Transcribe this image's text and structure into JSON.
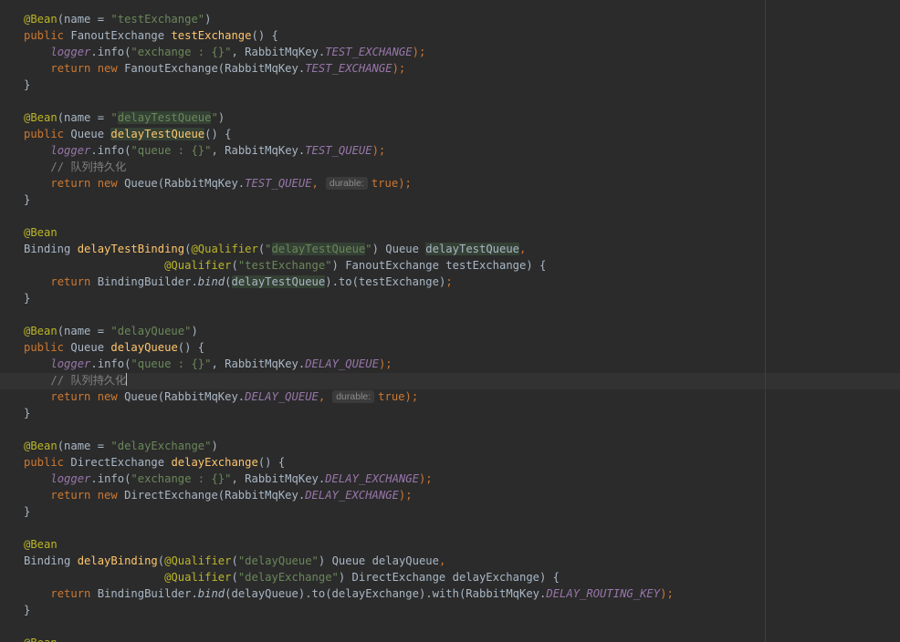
{
  "editor": {
    "lines": [
      {
        "indent": "",
        "tokens": [
          {
            "t": "@Bean",
            "c": "ann"
          },
          {
            "t": "(name = "
          },
          {
            "t": "\"testExchange\"",
            "c": "str"
          },
          {
            "t": ")"
          }
        ]
      },
      {
        "indent": "",
        "tokens": [
          {
            "t": "public",
            "c": "kw"
          },
          {
            "t": " FanoutExchange "
          },
          {
            "t": "testExchange",
            "c": "fn"
          },
          {
            "t": "() {"
          }
        ]
      },
      {
        "indent": "    ",
        "tokens": [
          {
            "t": "logger",
            "c": "field italic"
          },
          {
            "t": ".info("
          },
          {
            "t": "\"exchange : {}\"",
            "c": "str"
          },
          {
            "t": ", RabbitMqKey."
          },
          {
            "t": "TEST_EXCHANGE",
            "c": "const"
          },
          {
            "t": ");",
            "c": "kw"
          }
        ]
      },
      {
        "indent": "    ",
        "tokens": [
          {
            "t": "return new",
            "c": "kw"
          },
          {
            "t": " FanoutExchange(RabbitMqKey."
          },
          {
            "t": "TEST_EXCHANGE",
            "c": "const"
          },
          {
            "t": ");",
            "c": "kw"
          }
        ]
      },
      {
        "indent": "",
        "tokens": [
          {
            "t": "}"
          }
        ]
      },
      {
        "indent": "",
        "tokens": []
      },
      {
        "indent": "",
        "tokens": [
          {
            "t": "@Bean",
            "c": "ann"
          },
          {
            "t": "(name = "
          },
          {
            "t": "\"",
            "c": "str"
          },
          {
            "t": "delayTestQueue",
            "c": "str hl"
          },
          {
            "t": "\"",
            "c": "str"
          },
          {
            "t": ")"
          }
        ]
      },
      {
        "indent": "",
        "tokens": [
          {
            "t": "public",
            "c": "kw"
          },
          {
            "t": " Queue "
          },
          {
            "t": "delayTestQueue",
            "c": "fn hl"
          },
          {
            "t": "() {"
          }
        ]
      },
      {
        "indent": "    ",
        "tokens": [
          {
            "t": "logger",
            "c": "field italic"
          },
          {
            "t": ".info("
          },
          {
            "t": "\"queue : {}\"",
            "c": "str"
          },
          {
            "t": ", RabbitMqKey."
          },
          {
            "t": "TEST_QUEUE",
            "c": "const"
          },
          {
            "t": ");",
            "c": "kw"
          }
        ]
      },
      {
        "indent": "    ",
        "tokens": [
          {
            "t": "// 队列持久化",
            "c": "comment"
          }
        ]
      },
      {
        "indent": "    ",
        "tokens": [
          {
            "t": "return new",
            "c": "kw"
          },
          {
            "t": " Queue(RabbitMqKey."
          },
          {
            "t": "TEST_QUEUE",
            "c": "const"
          },
          {
            "t": ",",
            "c": "kw"
          },
          {
            "t": "durable:",
            "hint": true
          },
          {
            "t": "true",
            "c": "kw"
          },
          {
            "t": ");",
            "c": "kw"
          }
        ]
      },
      {
        "indent": "",
        "tokens": [
          {
            "t": "}"
          }
        ]
      },
      {
        "indent": "",
        "tokens": []
      },
      {
        "indent": "",
        "tokens": [
          {
            "t": "@Bean",
            "c": "ann"
          }
        ]
      },
      {
        "indent": "",
        "tokens": [
          {
            "t": "Binding "
          },
          {
            "t": "delayTestBinding",
            "c": "fn"
          },
          {
            "t": "("
          },
          {
            "t": "@Qualifier",
            "c": "ann"
          },
          {
            "t": "("
          },
          {
            "t": "\"",
            "c": "str"
          },
          {
            "t": "delayTestQueue",
            "c": "str hl"
          },
          {
            "t": "\"",
            "c": "str"
          },
          {
            "t": ") Queue "
          },
          {
            "t": "delayTestQueue",
            "c": "hl"
          },
          {
            "t": ",",
            "c": "kw"
          }
        ]
      },
      {
        "indent": "                     ",
        "tokens": [
          {
            "t": "@Qualifier",
            "c": "ann"
          },
          {
            "t": "("
          },
          {
            "t": "\"testExchange\"",
            "c": "str"
          },
          {
            "t": ") FanoutExchange testExchange) {"
          }
        ]
      },
      {
        "indent": "    ",
        "tokens": [
          {
            "t": "return",
            "c": "kw"
          },
          {
            "t": " BindingBuilder."
          },
          {
            "t": "bind",
            "c": "italic"
          },
          {
            "t": "("
          },
          {
            "t": "delayTestQueue",
            "c": "hl"
          },
          {
            "t": ").to(testExchange)"
          },
          {
            "t": ";",
            "c": "kw"
          }
        ]
      },
      {
        "indent": "",
        "tokens": [
          {
            "t": "}"
          }
        ]
      },
      {
        "indent": "",
        "tokens": []
      },
      {
        "indent": "",
        "tokens": [
          {
            "t": "@Bean",
            "c": "ann"
          },
          {
            "t": "(name = "
          },
          {
            "t": "\"delayQueue\"",
            "c": "str"
          },
          {
            "t": ")"
          }
        ]
      },
      {
        "indent": "",
        "tokens": [
          {
            "t": "public",
            "c": "kw"
          },
          {
            "t": " Queue "
          },
          {
            "t": "delayQueue",
            "c": "fn"
          },
          {
            "t": "() {"
          }
        ]
      },
      {
        "indent": "    ",
        "tokens": [
          {
            "t": "logger",
            "c": "field italic"
          },
          {
            "t": ".info("
          },
          {
            "t": "\"queue : {}\"",
            "c": "str"
          },
          {
            "t": ", RabbitMqKey."
          },
          {
            "t": "DELAY_QUEUE",
            "c": "const"
          },
          {
            "t": ");",
            "c": "kw"
          }
        ]
      },
      {
        "indent": "    ",
        "caret": true,
        "tokens": [
          {
            "t": "// 队列持久化",
            "c": "comment"
          }
        ]
      },
      {
        "indent": "    ",
        "tokens": [
          {
            "t": "return new",
            "c": "kw"
          },
          {
            "t": " Queue(RabbitMqKey."
          },
          {
            "t": "DELAY_QUEUE",
            "c": "const"
          },
          {
            "t": ",",
            "c": "kw"
          },
          {
            "t": "durable:",
            "hint": true
          },
          {
            "t": "true",
            "c": "kw"
          },
          {
            "t": ");",
            "c": "kw"
          }
        ]
      },
      {
        "indent": "",
        "tokens": [
          {
            "t": "}"
          }
        ]
      },
      {
        "indent": "",
        "tokens": []
      },
      {
        "indent": "",
        "tokens": [
          {
            "t": "@Bean",
            "c": "ann"
          },
          {
            "t": "(name = "
          },
          {
            "t": "\"delayExchange\"",
            "c": "str"
          },
          {
            "t": ")"
          }
        ]
      },
      {
        "indent": "",
        "tokens": [
          {
            "t": "public",
            "c": "kw"
          },
          {
            "t": " DirectExchange "
          },
          {
            "t": "delayExchange",
            "c": "fn"
          },
          {
            "t": "() {"
          }
        ]
      },
      {
        "indent": "    ",
        "tokens": [
          {
            "t": "logger",
            "c": "field italic"
          },
          {
            "t": ".info("
          },
          {
            "t": "\"exchange : {}\"",
            "c": "str"
          },
          {
            "t": ", RabbitMqKey."
          },
          {
            "t": "DELAY_EXCHANGE",
            "c": "const"
          },
          {
            "t": ");",
            "c": "kw"
          }
        ]
      },
      {
        "indent": "    ",
        "tokens": [
          {
            "t": "return new",
            "c": "kw"
          },
          {
            "t": " DirectExchange(RabbitMqKey."
          },
          {
            "t": "DELAY_EXCHANGE",
            "c": "const"
          },
          {
            "t": ");",
            "c": "kw"
          }
        ]
      },
      {
        "indent": "",
        "tokens": [
          {
            "t": "}"
          }
        ]
      },
      {
        "indent": "",
        "tokens": []
      },
      {
        "indent": "",
        "tokens": [
          {
            "t": "@Bean",
            "c": "ann"
          }
        ]
      },
      {
        "indent": "",
        "tokens": [
          {
            "t": "Binding "
          },
          {
            "t": "delayBinding",
            "c": "fn"
          },
          {
            "t": "("
          },
          {
            "t": "@Qualifier",
            "c": "ann"
          },
          {
            "t": "("
          },
          {
            "t": "\"delayQueue\"",
            "c": "str"
          },
          {
            "t": ") Queue delayQueue"
          },
          {
            "t": ",",
            "c": "kw"
          }
        ]
      },
      {
        "indent": "                     ",
        "tokens": [
          {
            "t": "@Qualifier",
            "c": "ann"
          },
          {
            "t": "("
          },
          {
            "t": "\"delayExchange\"",
            "c": "str"
          },
          {
            "t": ") DirectExchange delayExchange) {"
          }
        ]
      },
      {
        "indent": "    ",
        "tokens": [
          {
            "t": "return",
            "c": "kw"
          },
          {
            "t": " BindingBuilder."
          },
          {
            "t": "bind",
            "c": "italic"
          },
          {
            "t": "(delayQueue).to(delayExchange).with(RabbitMqKey."
          },
          {
            "t": "DELAY_ROUTING_KEY",
            "c": "const"
          },
          {
            "t": ");",
            "c": "kw"
          }
        ]
      },
      {
        "indent": "",
        "tokens": [
          {
            "t": "}"
          }
        ]
      },
      {
        "indent": "",
        "tokens": []
      },
      {
        "indent": "",
        "tokens": [
          {
            "t": "@Bean",
            "c": "ann"
          }
        ]
      }
    ]
  }
}
